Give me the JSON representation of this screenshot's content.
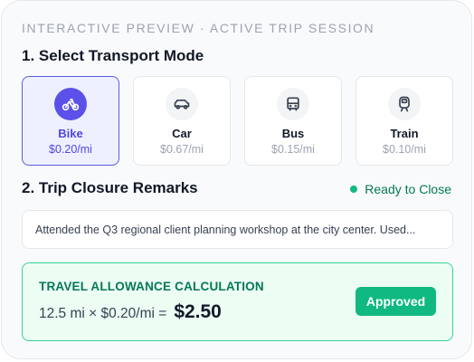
{
  "header": {
    "preview_label": "INTERACTIVE PREVIEW · ACTIVE TRIP SESSION"
  },
  "transport": {
    "title": "1. Select Transport Mode",
    "selected": "Bike",
    "modes": [
      {
        "name": "Bike",
        "rate": "$0.20/mi",
        "icon": "bike-icon"
      },
      {
        "name": "Car",
        "rate": "$0.67/mi",
        "icon": "car-icon"
      },
      {
        "name": "Bus",
        "rate": "$0.15/mi",
        "icon": "bus-icon"
      },
      {
        "name": "Train",
        "rate": "$0.10/mi",
        "icon": "train-icon"
      }
    ]
  },
  "remarks": {
    "title": "2. Trip Closure Remarks",
    "status": "Ready to Close",
    "value": "Attended the Q3 regional client planning workshop at the city center. Used..."
  },
  "allowance": {
    "title": "TRAVEL ALLOWANCE CALCULATION",
    "formula": "12.5 mi × $0.20/mi =",
    "total": "$2.50",
    "badge": "Approved"
  },
  "colors": {
    "accent": "#5b50e8",
    "success": "#10b981",
    "success_text": "#047857",
    "muted": "#9ca3af"
  }
}
